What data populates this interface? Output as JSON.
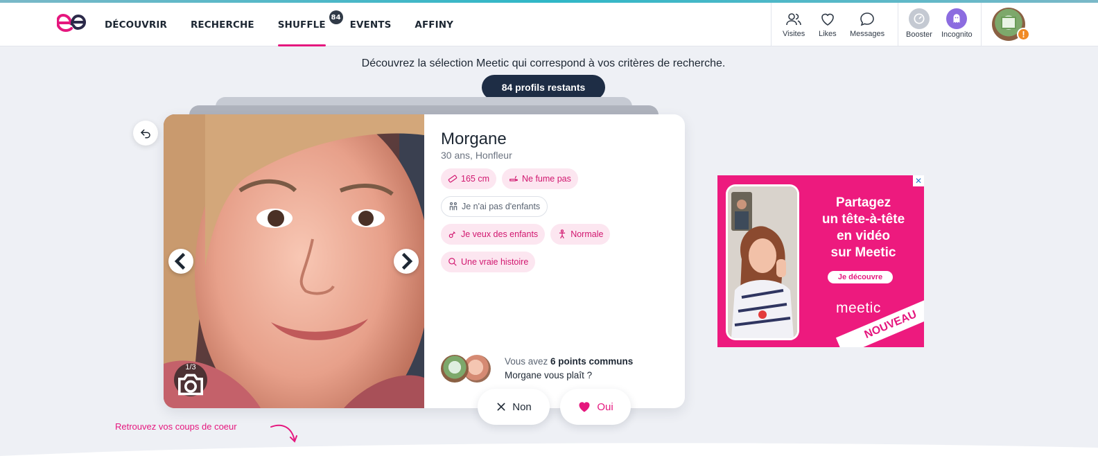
{
  "nav": {
    "items": [
      {
        "label": "DÉCOUVRIR"
      },
      {
        "label": "RECHERCHE"
      },
      {
        "label": "SHUFFLE",
        "badge": "84"
      },
      {
        "label": "EVENTS"
      },
      {
        "label": "AFFINY"
      }
    ],
    "active_index": 2
  },
  "header_actions": {
    "visites": "Visites",
    "likes": "Likes",
    "messages": "Messages",
    "booster": "Booster",
    "incognito": "Incognito",
    "alert_mark": "!"
  },
  "main": {
    "headline": "Découvrez la sélection Meetic qui correspond à vos critères de recherche.",
    "remaining": "84 profils restants"
  },
  "profile": {
    "name": "Morgane",
    "subtitle": "30 ans, Honfleur",
    "photo_counter": "1/3",
    "chips": [
      {
        "label": "165 cm",
        "icon": "ruler-icon"
      },
      {
        "label": "Ne fume pas",
        "icon": "no-smoking-icon"
      },
      {
        "label": "Je n'ai pas d'enfants",
        "icon": "family-icon"
      },
      {
        "label": "Je veux des enfants",
        "icon": "pacifier-icon"
      },
      {
        "label": "Normale",
        "icon": "body-icon"
      },
      {
        "label": "Une vraie histoire",
        "icon": "search-icon"
      }
    ],
    "common_prefix": "Vous avez ",
    "common_count": "6 points communs",
    "common_question": "Morgane vous plaît ?"
  },
  "actions": {
    "non": "Non",
    "oui": "Oui"
  },
  "footer": {
    "coups_de_coeur": "Retrouvez vos coups de coeur"
  },
  "ad": {
    "title_lines": [
      "Partagez",
      "un tête-à-tête",
      "en vidéo",
      "sur Meetic"
    ],
    "cta": "Je découvre",
    "brand": "meetic",
    "ribbon": "NOUVEAU",
    "close": "✕"
  },
  "colors": {
    "brand_pink": "#e5177e",
    "navy": "#1e2d45",
    "background": "#eef0f5"
  }
}
